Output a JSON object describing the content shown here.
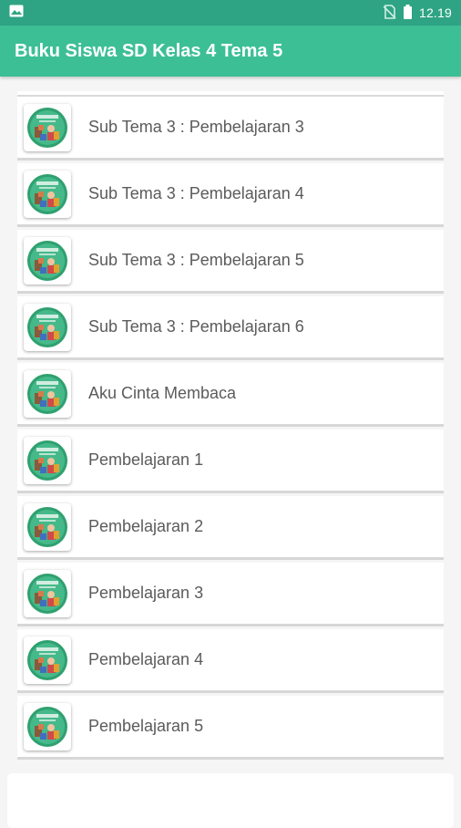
{
  "status_bar": {
    "time": "12.19",
    "left_icon": "image-icon",
    "right_icons": [
      "no-sim-icon",
      "battery-icon"
    ]
  },
  "app_bar": {
    "title": "Buku Siswa SD Kelas 4 Tema 5"
  },
  "list": {
    "items": [
      {
        "label": "Sub Tema 3 : Pembelajaran 3",
        "icon": "book-cover-icon"
      },
      {
        "label": "Sub Tema 3 : Pembelajaran 4",
        "icon": "book-cover-icon"
      },
      {
        "label": "Sub Tema 3 : Pembelajaran 5",
        "icon": "book-cover-icon"
      },
      {
        "label": "Sub Tema 3 : Pembelajaran 6",
        "icon": "book-cover-icon"
      },
      {
        "label": "Aku Cinta Membaca",
        "icon": "book-cover-icon"
      },
      {
        "label": "Pembelajaran 1",
        "icon": "book-cover-icon"
      },
      {
        "label": "Pembelajaran 2",
        "icon": "book-cover-icon"
      },
      {
        "label": "Pembelajaran 3",
        "icon": "book-cover-icon"
      },
      {
        "label": "Pembelajaran 4",
        "icon": "book-cover-icon"
      },
      {
        "label": "Pembelajaran 5",
        "icon": "book-cover-icon"
      }
    ]
  },
  "colors": {
    "status_bar": "#2ea484",
    "app_bar": "#3dbf96",
    "background": "#f5f5f5",
    "item_text": "#5b5b5b"
  }
}
